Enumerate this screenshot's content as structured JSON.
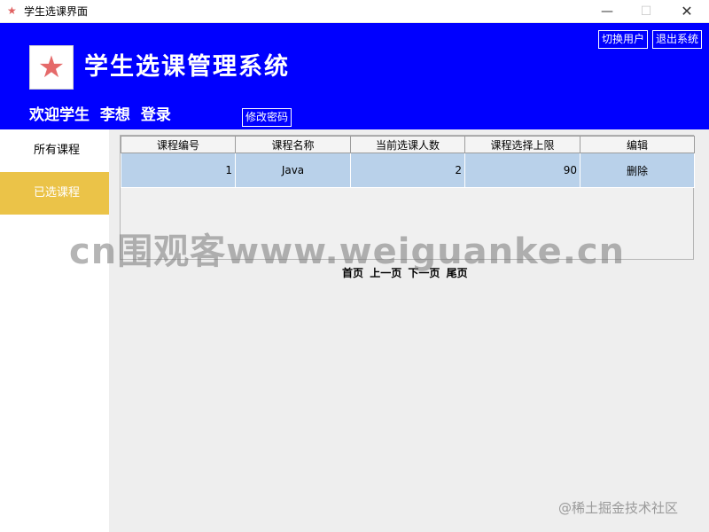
{
  "window": {
    "title": "学生选课界面",
    "icons": {
      "app": "red-star-icon",
      "minimize": "minimize-icon",
      "maximize": "maximize-icon",
      "close": "close-icon"
    }
  },
  "header": {
    "system_title": "学生选课管理系统",
    "welcome_text": "欢迎学生 李想 登录",
    "switch_user_label": "切换用户",
    "exit_label": "退出系统",
    "change_password_label": "修改密码",
    "background_color": "#0000ff",
    "logo_icon": "star-icon"
  },
  "sidebar": {
    "items": [
      {
        "label": "所有课程",
        "active": false
      },
      {
        "label": "已选课程",
        "active": true
      }
    ],
    "active_color": "#ebc348"
  },
  "table": {
    "columns": [
      "课程编号",
      "课程名称",
      "当前选课人数",
      "课程选择上限",
      "编辑"
    ],
    "rows": [
      {
        "id": "1",
        "name": "Java",
        "current": "2",
        "limit": "90",
        "action": "删除"
      }
    ],
    "selected_row_color": "#b9d1ea"
  },
  "pagination": {
    "first": "首页",
    "prev": "上一页",
    "next": "下一页",
    "last": "尾页"
  },
  "overlay": {
    "watermark": "cn围观客www.weiguanke.cn",
    "credit": "@稀土掘金技术社区"
  }
}
